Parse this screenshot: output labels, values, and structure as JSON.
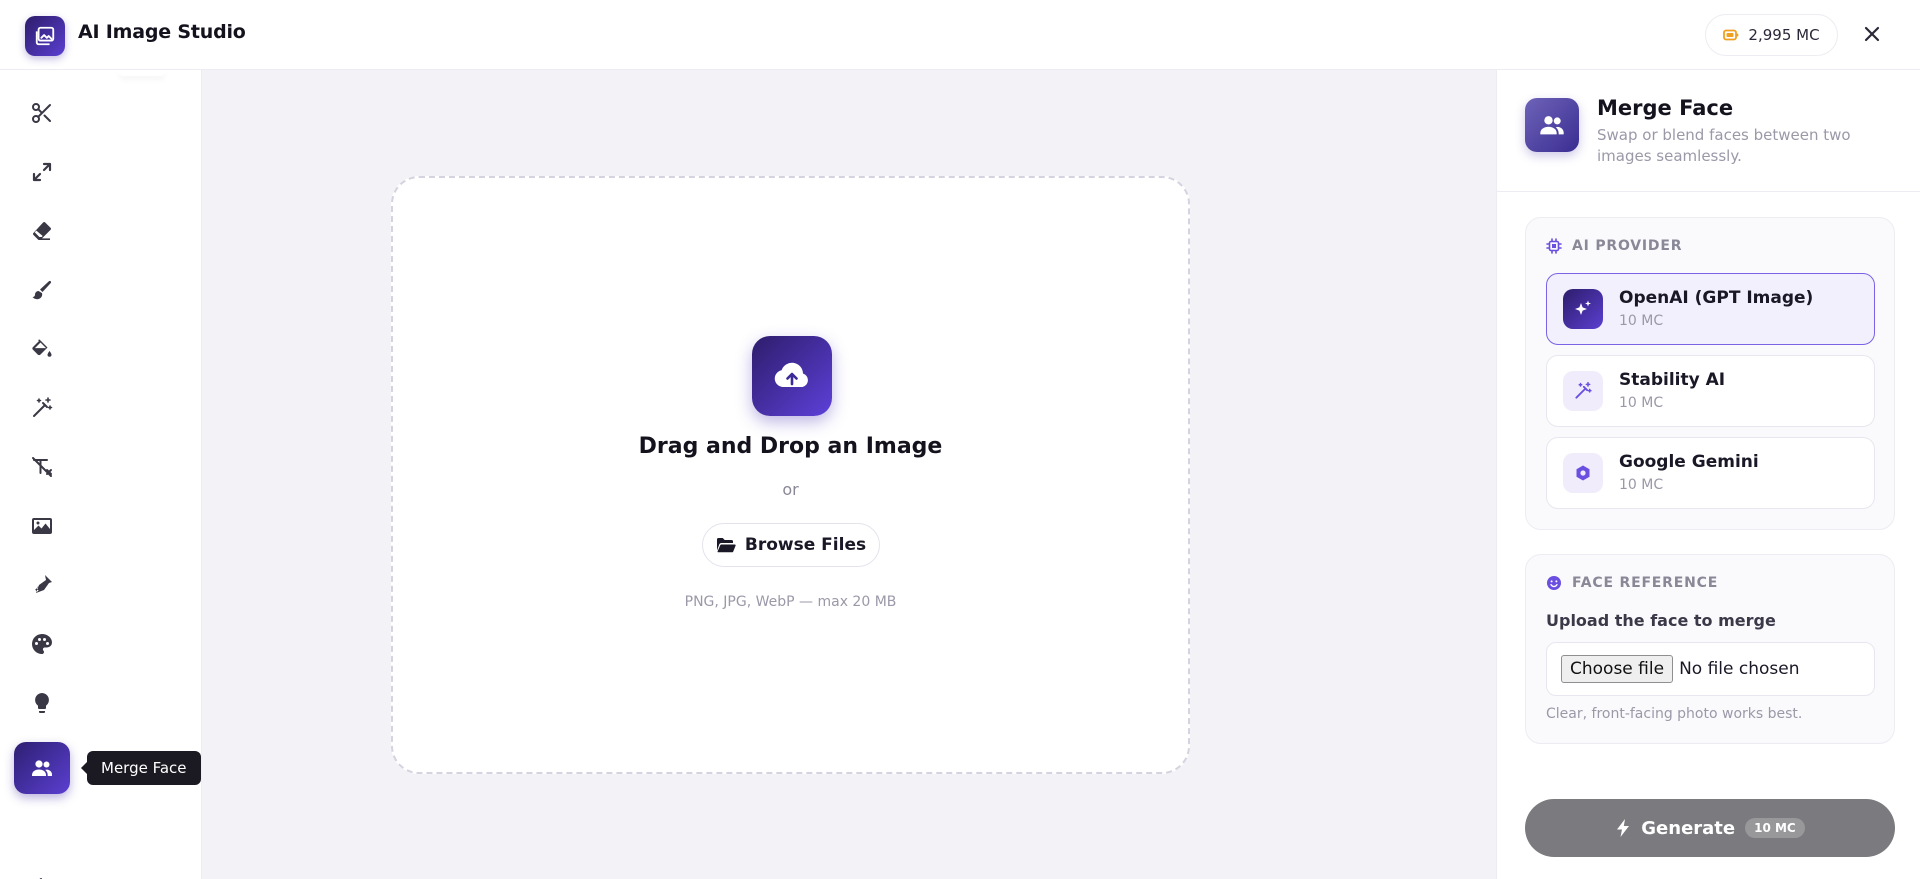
{
  "header": {
    "app_title": "AI Image Studio",
    "credits": "2,995 MC",
    "logo_icon": "image-icon",
    "close_icon": "close-icon"
  },
  "sidebar": {
    "tools": [
      {
        "icon": "scissors-icon"
      },
      {
        "icon": "expand-icon"
      },
      {
        "icon": "eraser-icon"
      },
      {
        "icon": "brush-icon"
      },
      {
        "icon": "paint-bucket-icon"
      },
      {
        "icon": "magic-wand-icon"
      },
      {
        "icon": "text-remove-icon"
      },
      {
        "icon": "image-icon"
      },
      {
        "icon": "pen-nib-icon"
      },
      {
        "icon": "palette-icon"
      },
      {
        "icon": "lightbulb-icon"
      },
      {
        "icon": "users-icon",
        "active": true
      }
    ],
    "tooltip": "Merge Face",
    "collapse_icon": "arrow-left-icon"
  },
  "dropzone": {
    "title": "Drag and Drop an Image",
    "or_text": "or",
    "browse_label": "Browse Files",
    "hint": "PNG, JPG, WebP — max 20 MB"
  },
  "panel": {
    "title": "Merge Face",
    "subtitle": "Swap or blend faces between two images seamlessly.",
    "provider_section": {
      "heading": "AI PROVIDER",
      "providers": [
        {
          "name": "OpenAI (GPT Image)",
          "cost": "10 MC",
          "selected": true,
          "icon": "sparkles-icon"
        },
        {
          "name": "Stability AI",
          "cost": "10 MC",
          "selected": false,
          "icon": "magic-wand-icon"
        },
        {
          "name": "Google Gemini",
          "cost": "10 MC",
          "selected": false,
          "icon": "gem-icon"
        }
      ]
    },
    "face_section": {
      "heading": "FACE REFERENCE",
      "label": "Upload the face to merge",
      "choose_label": "Choose file",
      "file_status": "No file chosen",
      "hint": "Clear, front-facing photo works best."
    },
    "generate": {
      "label": "Generate",
      "cost": "10 MC"
    }
  },
  "colors": {
    "accent": "#5a3fd1",
    "accent_dark": "#2d1d6b",
    "generate_bg": "#7b7b7f",
    "credit_icon": "#f0a020"
  }
}
